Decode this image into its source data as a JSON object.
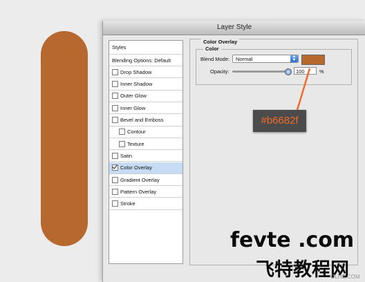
{
  "dialog": {
    "title": "Layer Style"
  },
  "styles_list": {
    "header": "Styles",
    "items": [
      {
        "label": "Blending Options: Default",
        "checkbox": false,
        "checked": false,
        "selected": false,
        "indent": false
      },
      {
        "label": "Drop Shadow",
        "checkbox": true,
        "checked": false,
        "selected": false,
        "indent": false
      },
      {
        "label": "Inner Shadow",
        "checkbox": true,
        "checked": false,
        "selected": false,
        "indent": false
      },
      {
        "label": "Outer Glow",
        "checkbox": true,
        "checked": false,
        "selected": false,
        "indent": false
      },
      {
        "label": "Inner Glow",
        "checkbox": true,
        "checked": false,
        "selected": false,
        "indent": false
      },
      {
        "label": "Bevel and Emboss",
        "checkbox": true,
        "checked": false,
        "selected": false,
        "indent": false
      },
      {
        "label": "Contour",
        "checkbox": true,
        "checked": false,
        "selected": false,
        "indent": true
      },
      {
        "label": "Texture",
        "checkbox": true,
        "checked": false,
        "selected": false,
        "indent": true
      },
      {
        "label": "Satin",
        "checkbox": true,
        "checked": false,
        "selected": false,
        "indent": false
      },
      {
        "label": "Color Overlay",
        "checkbox": true,
        "checked": true,
        "selected": true,
        "indent": false
      },
      {
        "label": "Gradient Overlay",
        "checkbox": true,
        "checked": false,
        "selected": false,
        "indent": false
      },
      {
        "label": "Pattern Overlay",
        "checkbox": true,
        "checked": false,
        "selected": false,
        "indent": false
      },
      {
        "label": "Stroke",
        "checkbox": true,
        "checked": false,
        "selected": false,
        "indent": false
      }
    ]
  },
  "color_overlay": {
    "title": "Color Overlay",
    "group_title": "Color",
    "blend_mode_label": "Blend Mode:",
    "blend_mode_value": "Normal",
    "opacity_label": "Opacity:",
    "opacity_value": "100",
    "opacity_unit": "%",
    "opacity_level": 1.0
  },
  "callout": {
    "hex": "#b6682f"
  },
  "colors": {
    "overlay": "#b6682f",
    "callout_text": "#f06b2a",
    "callout_bg": "#4c4b4b",
    "selection": "#c6dcf5"
  },
  "watermark": {
    "line1": "fevte .com",
    "line2": "飞特教程网",
    "line3": "OLHE.COM"
  },
  "icons": {
    "select_arrows": "up-down-arrows-icon",
    "check": "checkmark-icon"
  }
}
